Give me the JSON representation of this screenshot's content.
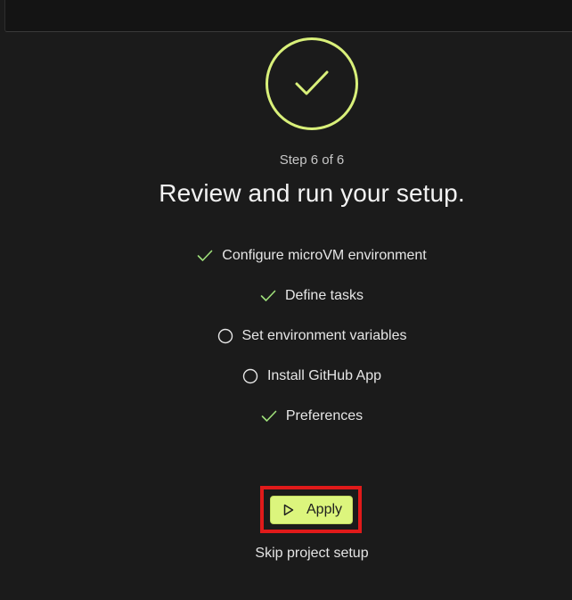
{
  "header": {
    "step_label": "Step 6 of 6",
    "title": "Review and run your setup."
  },
  "checklist": [
    {
      "label": "Configure microVM environment",
      "status": "complete",
      "icon": "check-icon"
    },
    {
      "label": "Define tasks",
      "status": "complete",
      "icon": "check-icon"
    },
    {
      "label": "Set environment variables",
      "status": "incomplete",
      "icon": "empty-circle-icon"
    },
    {
      "label": "Install GitHub App",
      "status": "incomplete",
      "icon": "empty-circle-icon"
    },
    {
      "label": "Preferences",
      "status": "complete",
      "icon": "check-icon"
    }
  ],
  "actions": {
    "apply_label": "Apply",
    "apply_icon": "play-icon",
    "skip_label": "Skip project setup"
  },
  "colors": {
    "accent": "#dcf57d",
    "check": "#9fe07a",
    "highlight_border": "#e01a1a",
    "background": "#1b1b1b"
  }
}
